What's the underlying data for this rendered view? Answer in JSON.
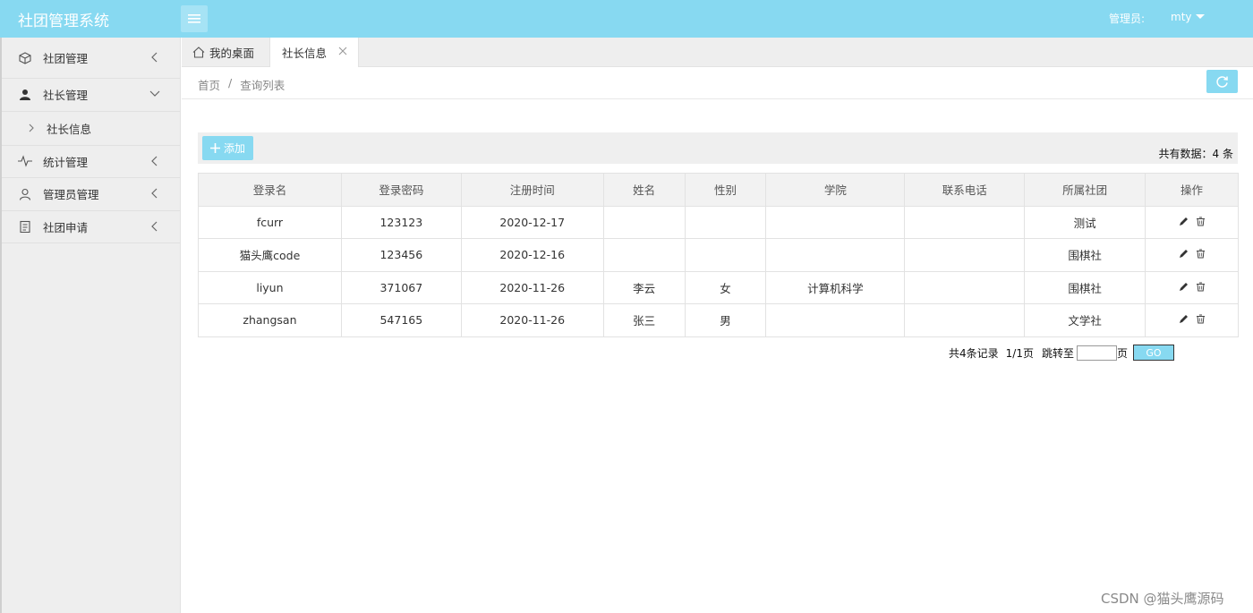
{
  "header": {
    "app_title": "社团管理系统",
    "admin_label": "管理员:",
    "admin_user": "mty"
  },
  "sidebar": {
    "items": [
      {
        "label": "社团管理",
        "icon": "cube-icon"
      },
      {
        "label": "社长管理",
        "icon": "user-icon"
      },
      {
        "label": "统计管理",
        "icon": "pulse-icon"
      },
      {
        "label": "管理员管理",
        "icon": "person-outline-icon"
      },
      {
        "label": "社团申请",
        "icon": "clipboard-icon"
      }
    ],
    "sub_items": [
      {
        "label": "社长信息"
      }
    ]
  },
  "tabs": [
    {
      "label": "我的桌面"
    },
    {
      "label": "社长信息"
    }
  ],
  "breadcrumb": {
    "home": "首页",
    "separator": "/",
    "current": "查询列表"
  },
  "toolbar": {
    "add_label": "添加",
    "total_label": "共有数据：4 条"
  },
  "table": {
    "headers": [
      "登录名",
      "登录密码",
      "注册时间",
      "姓名",
      "性别",
      "学院",
      "联系电话",
      "所属社团",
      "操作"
    ],
    "rows": [
      [
        "fcurr",
        "123123",
        "2020-12-17",
        "",
        "",
        "",
        "",
        "测试"
      ],
      [
        "猫头鹰code",
        "123456",
        "2020-12-16",
        "",
        "",
        "",
        "",
        "围棋社"
      ],
      [
        "liyun",
        "371067",
        "2020-11-26",
        "李云",
        "女",
        "计算机科学",
        "",
        "围棋社"
      ],
      [
        "zhangsan",
        "547165",
        "2020-11-26",
        "张三",
        "男",
        "",
        "",
        "文学社"
      ]
    ]
  },
  "pager": {
    "records": "共4条记录",
    "pages": "1/1页",
    "jump_label": "跳转至",
    "page_unit": "页",
    "go_label": "GO"
  },
  "watermark": "CSDN @猫头鹰源码",
  "colors": {
    "accent": "#87d9f1",
    "sidebar_bg": "#eeeeee"
  }
}
